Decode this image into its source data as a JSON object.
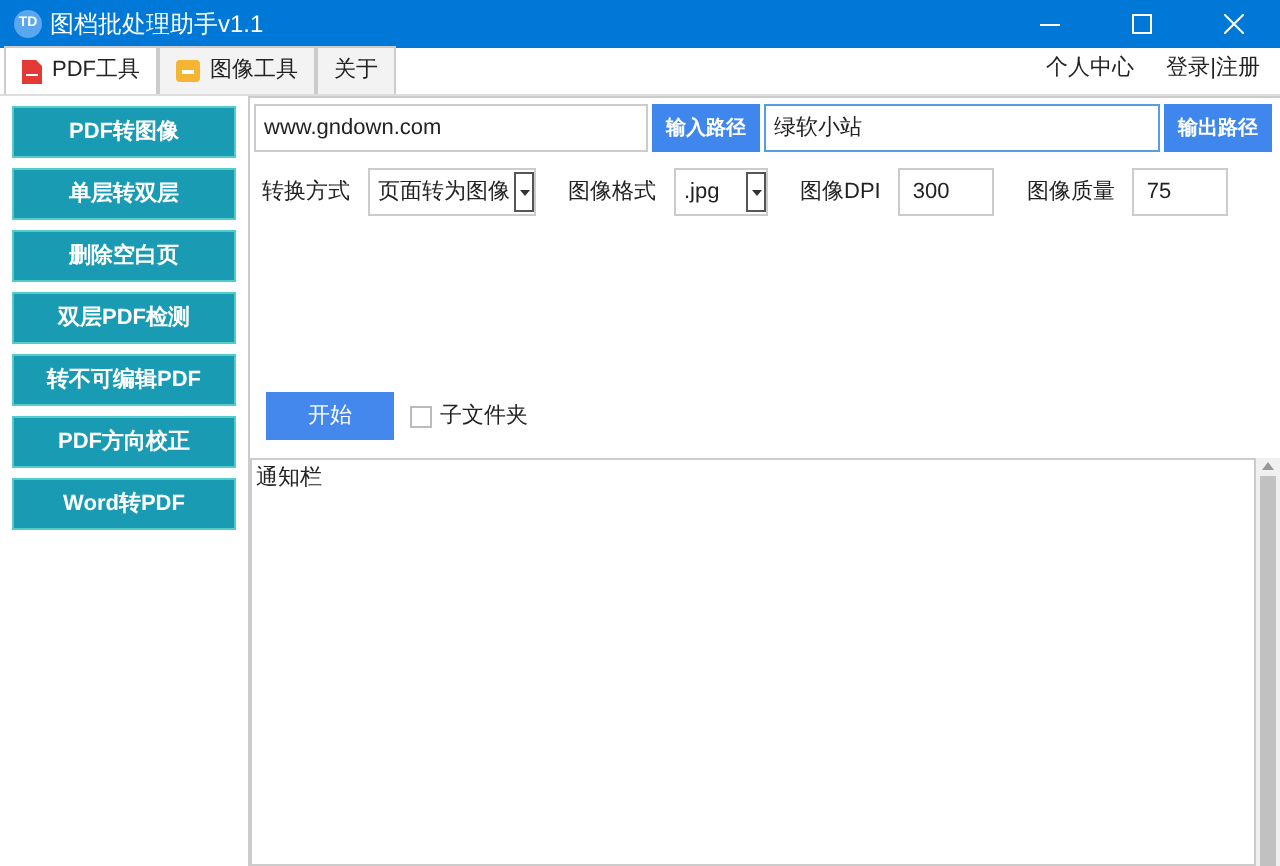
{
  "window": {
    "title": "图档批处理助手v1.1",
    "logo": "TD"
  },
  "tabs": [
    {
      "label": "PDF工具",
      "kind": "pdf",
      "selected": true
    },
    {
      "label": "图像工具",
      "kind": "image",
      "selected": false
    },
    {
      "label": "关于",
      "selected": false
    }
  ],
  "header_links": [
    "个人中心",
    "登录|注册"
  ],
  "sidebar": {
    "items": [
      "PDF转图像",
      "单层转双层",
      "删除空白页",
      "双层PDF检测",
      "转不可编辑PDF",
      "PDF方向校正",
      "Word转PDF"
    ]
  },
  "input_path": {
    "value": "www.gndown.com",
    "button": "输入路径"
  },
  "output_path": {
    "value": "绿软小站",
    "button": "输出路径"
  },
  "options": [
    {
      "kind": "select",
      "label": "转换方式",
      "value": "页面转为图像"
    },
    {
      "kind": "select",
      "label": "图像格式",
      "value": ".jpg"
    },
    {
      "kind": "input",
      "label": "图像DPI",
      "value": "300"
    },
    {
      "kind": "input",
      "label": "图像质量",
      "value": "75"
    }
  ],
  "start_button": "开始",
  "subfolder": {
    "label": "子文件夹",
    "checked": false
  },
  "notice": {
    "text": "通知栏"
  }
}
